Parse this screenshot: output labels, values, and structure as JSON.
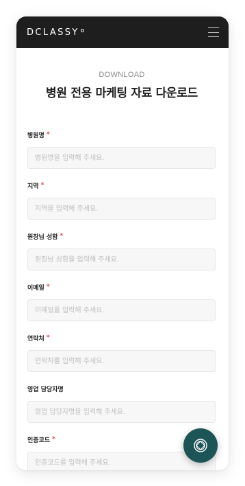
{
  "header": {
    "logo": "DCLASSY",
    "menu_icon": "hamburger-menu-icon"
  },
  "page": {
    "eyebrow": "DOWNLOAD",
    "title": "병원 전용 마케팅 자료 다운로드"
  },
  "form": {
    "required_mark": "*",
    "fields": [
      {
        "label": "병원명",
        "required": true,
        "placeholder": "병원명을 입력해 주세요."
      },
      {
        "label": "지역",
        "required": true,
        "placeholder": "지역을 입력해 주세요."
      },
      {
        "label": "원장님 성함",
        "required": true,
        "placeholder": "원장님 성함을 입력해 주세요."
      },
      {
        "label": "이메일",
        "required": true,
        "placeholder": "이메일을 입력해 주세요."
      },
      {
        "label": "연락처",
        "required": true,
        "placeholder": "연락처를 입력해 주세요."
      },
      {
        "label": "영업 담당자명",
        "required": false,
        "placeholder": "영업 담당자명을 입력해 주세요."
      },
      {
        "label": "인증코드",
        "required": true,
        "placeholder": "인증코드를 입력해 주세요."
      }
    ]
  },
  "fab": {
    "icon": "chat-ring-icon"
  },
  "colors": {
    "header_bg": "#1e1e1e",
    "required": "#e53935",
    "fab_bg": "#1d5456"
  }
}
